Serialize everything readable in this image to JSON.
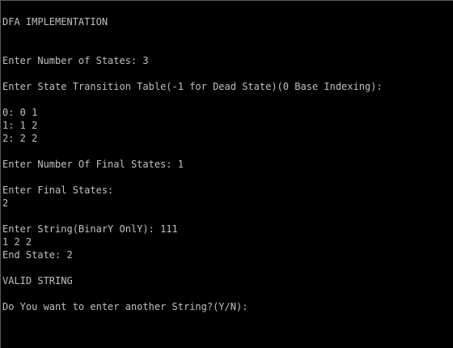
{
  "console": {
    "text_color": "#c0c0c0",
    "background_color": "#000000",
    "lines": [
      "DFA IMPLEMENTATION",
      "",
      "",
      "Enter Number of States: 3",
      "",
      "Enter State Transition Table(-1 for Dead State)(0 Base Indexing):",
      "",
      "0: 0 1",
      "1: 1 2",
      "2: 2 2",
      "",
      "Enter Number Of Final States: 1",
      "",
      "Enter Final States:",
      "2",
      "",
      "Enter String(BinarY OnlY): 111",
      "1 2 2",
      "End State: 2",
      "",
      "VALID STRING",
      "",
      "Do You want to enter another String?(Y/N):"
    ]
  }
}
